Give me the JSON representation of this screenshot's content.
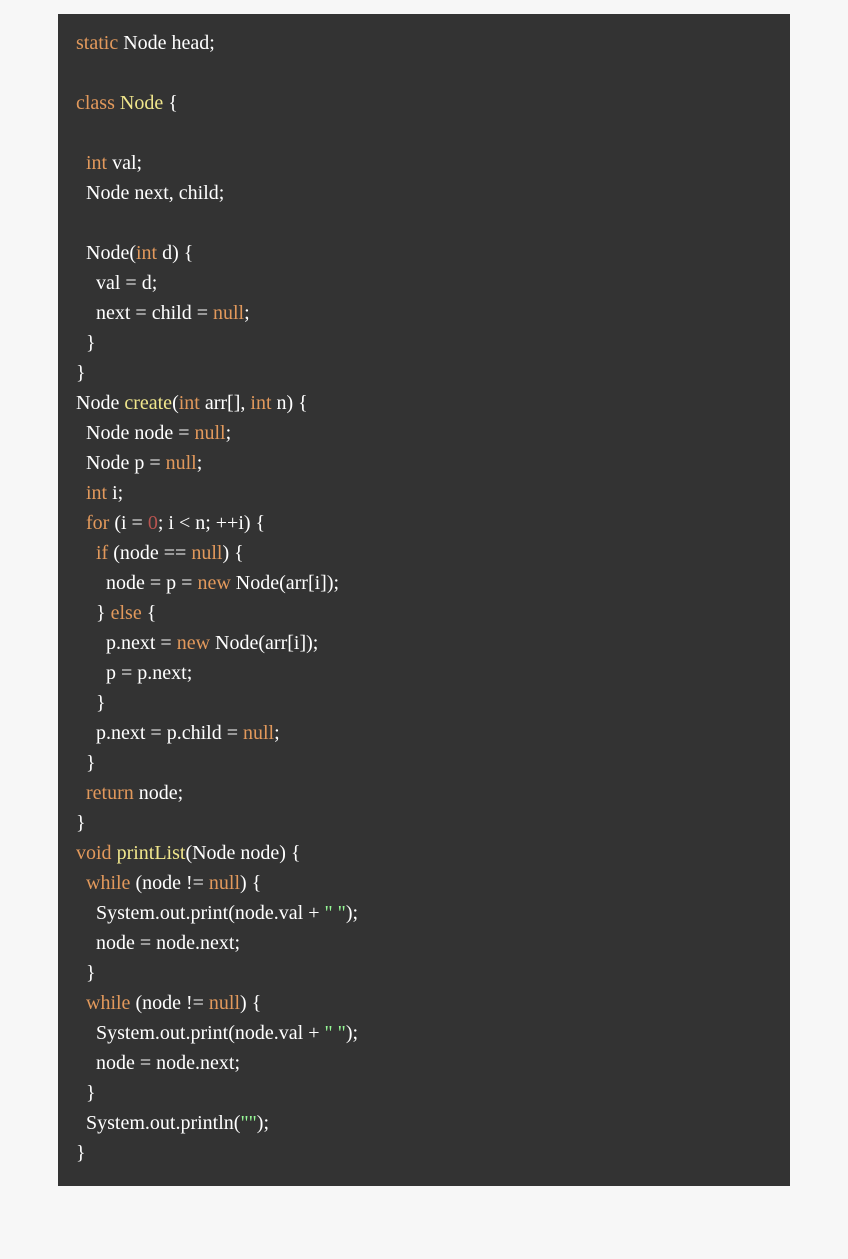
{
  "tokens": {
    "static": "static",
    "class": "class",
    "int": "int",
    "for": "for",
    "if": "if",
    "else": "else",
    "while": "while",
    "return": "return",
    "void": "void",
    "new": "new",
    "null": "null",
    "zero": "0",
    "Node": "Node",
    "create": "create",
    "printList": "printList",
    "head": " Node head;",
    "nodeOpen": " {",
    "valDecl": " val;",
    "nextChildDecl": "  Node next, child;",
    "nodeCtorA": "  Node(",
    "nodeCtorB": " d) {",
    "valAssign": "    val = d;",
    "nextChildNull_a": "    next = child = ",
    "semicolon": ";",
    "closeBrace2": "  }",
    "closeBrace1": "}",
    "createSig_a": "Node ",
    "createSig_b": "(",
    "createSig_c": " arr[], ",
    "createSig_d": " n) {",
    "nodeNull_a": "  Node node = ",
    "pNull_a": "  Node p = ",
    "iDecl_a": "  ",
    "iDecl_b": " i;",
    "forLine_a": "  ",
    "forLine_b": " (i = ",
    "forLine_c": "; i < n; ++i) {",
    "ifLine_a": "    ",
    "ifLine_b": " (node == ",
    "ifLine_c": ") {",
    "newNode1_a": "      node = p = ",
    "newNode1_b": " Node(arr[i]);",
    "elseLine_a": "    } ",
    "elseLine_b": " {",
    "newNode2_a": "      p.next = ",
    "newNode2_b": " Node(arr[i]);",
    "pNext": "      p = p.next;",
    "closeBrace4": "    }",
    "pNextChild_a": "    p.next = p.child = ",
    "returnNode_a": "  ",
    "returnNode_b": " node;",
    "printSig_a": " ",
    "printSig_b": "(Node node) {",
    "whileLine_a": "  ",
    "whileLine_b": " (node != ",
    "whileLine_c": ") {",
    "sysout_a": "    System.out.print(node.val + ",
    "strSpace": "\" \"",
    "sysout_b": ");",
    "nodeNext": "    node = node.next;",
    "sysoutln_a": "  System.out.println(",
    "strEmpty": "\"\"",
    "sysoutln_b": ");"
  }
}
